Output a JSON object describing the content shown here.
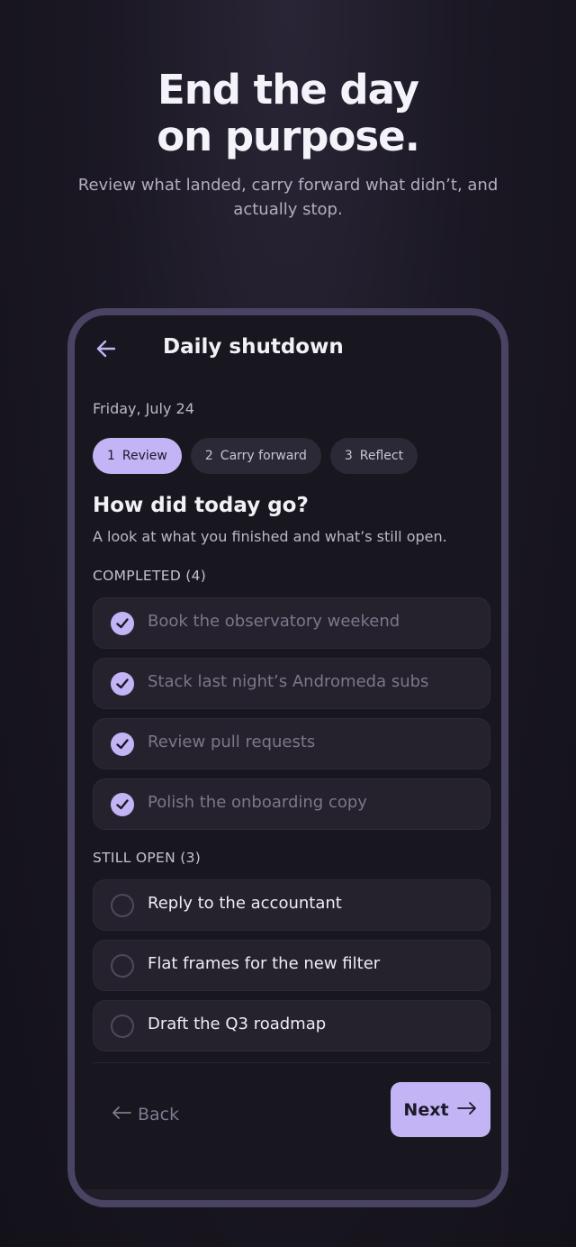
{
  "hero": {
    "title_line1": "End the day",
    "title_line2": "on purpose.",
    "subtitle_line1": "Review what landed, carry forward what didn’t, and",
    "subtitle_line2": "actually stop."
  },
  "screen": {
    "title": "Daily shutdown",
    "date": "Friday, July 24",
    "steps": [
      {
        "num": "1",
        "label": "Review",
        "active": true
      },
      {
        "num": "2",
        "label": "Carry forward",
        "active": false
      },
      {
        "num": "3",
        "label": "Reflect",
        "active": false
      }
    ],
    "question": "How did today go?",
    "question_sub": "A look at what you finished and what’s still open.",
    "completed_label": "COMPLETED (4)",
    "completed": [
      "Book the observatory weekend",
      "Stack last night’s Andromeda subs",
      "Review pull requests",
      "Polish the onboarding copy"
    ],
    "open_label": "STILL OPEN (3)",
    "open": [
      "Reply to the accountant",
      "Flat frames for the new filter",
      "Draft the Q3 roadmap"
    ],
    "back_label": "Back",
    "next_label": "Next"
  },
  "colors": {
    "accent": "#c3b4f5",
    "background": "#18161e",
    "card": "#25222e",
    "frame": "#4a4364"
  }
}
